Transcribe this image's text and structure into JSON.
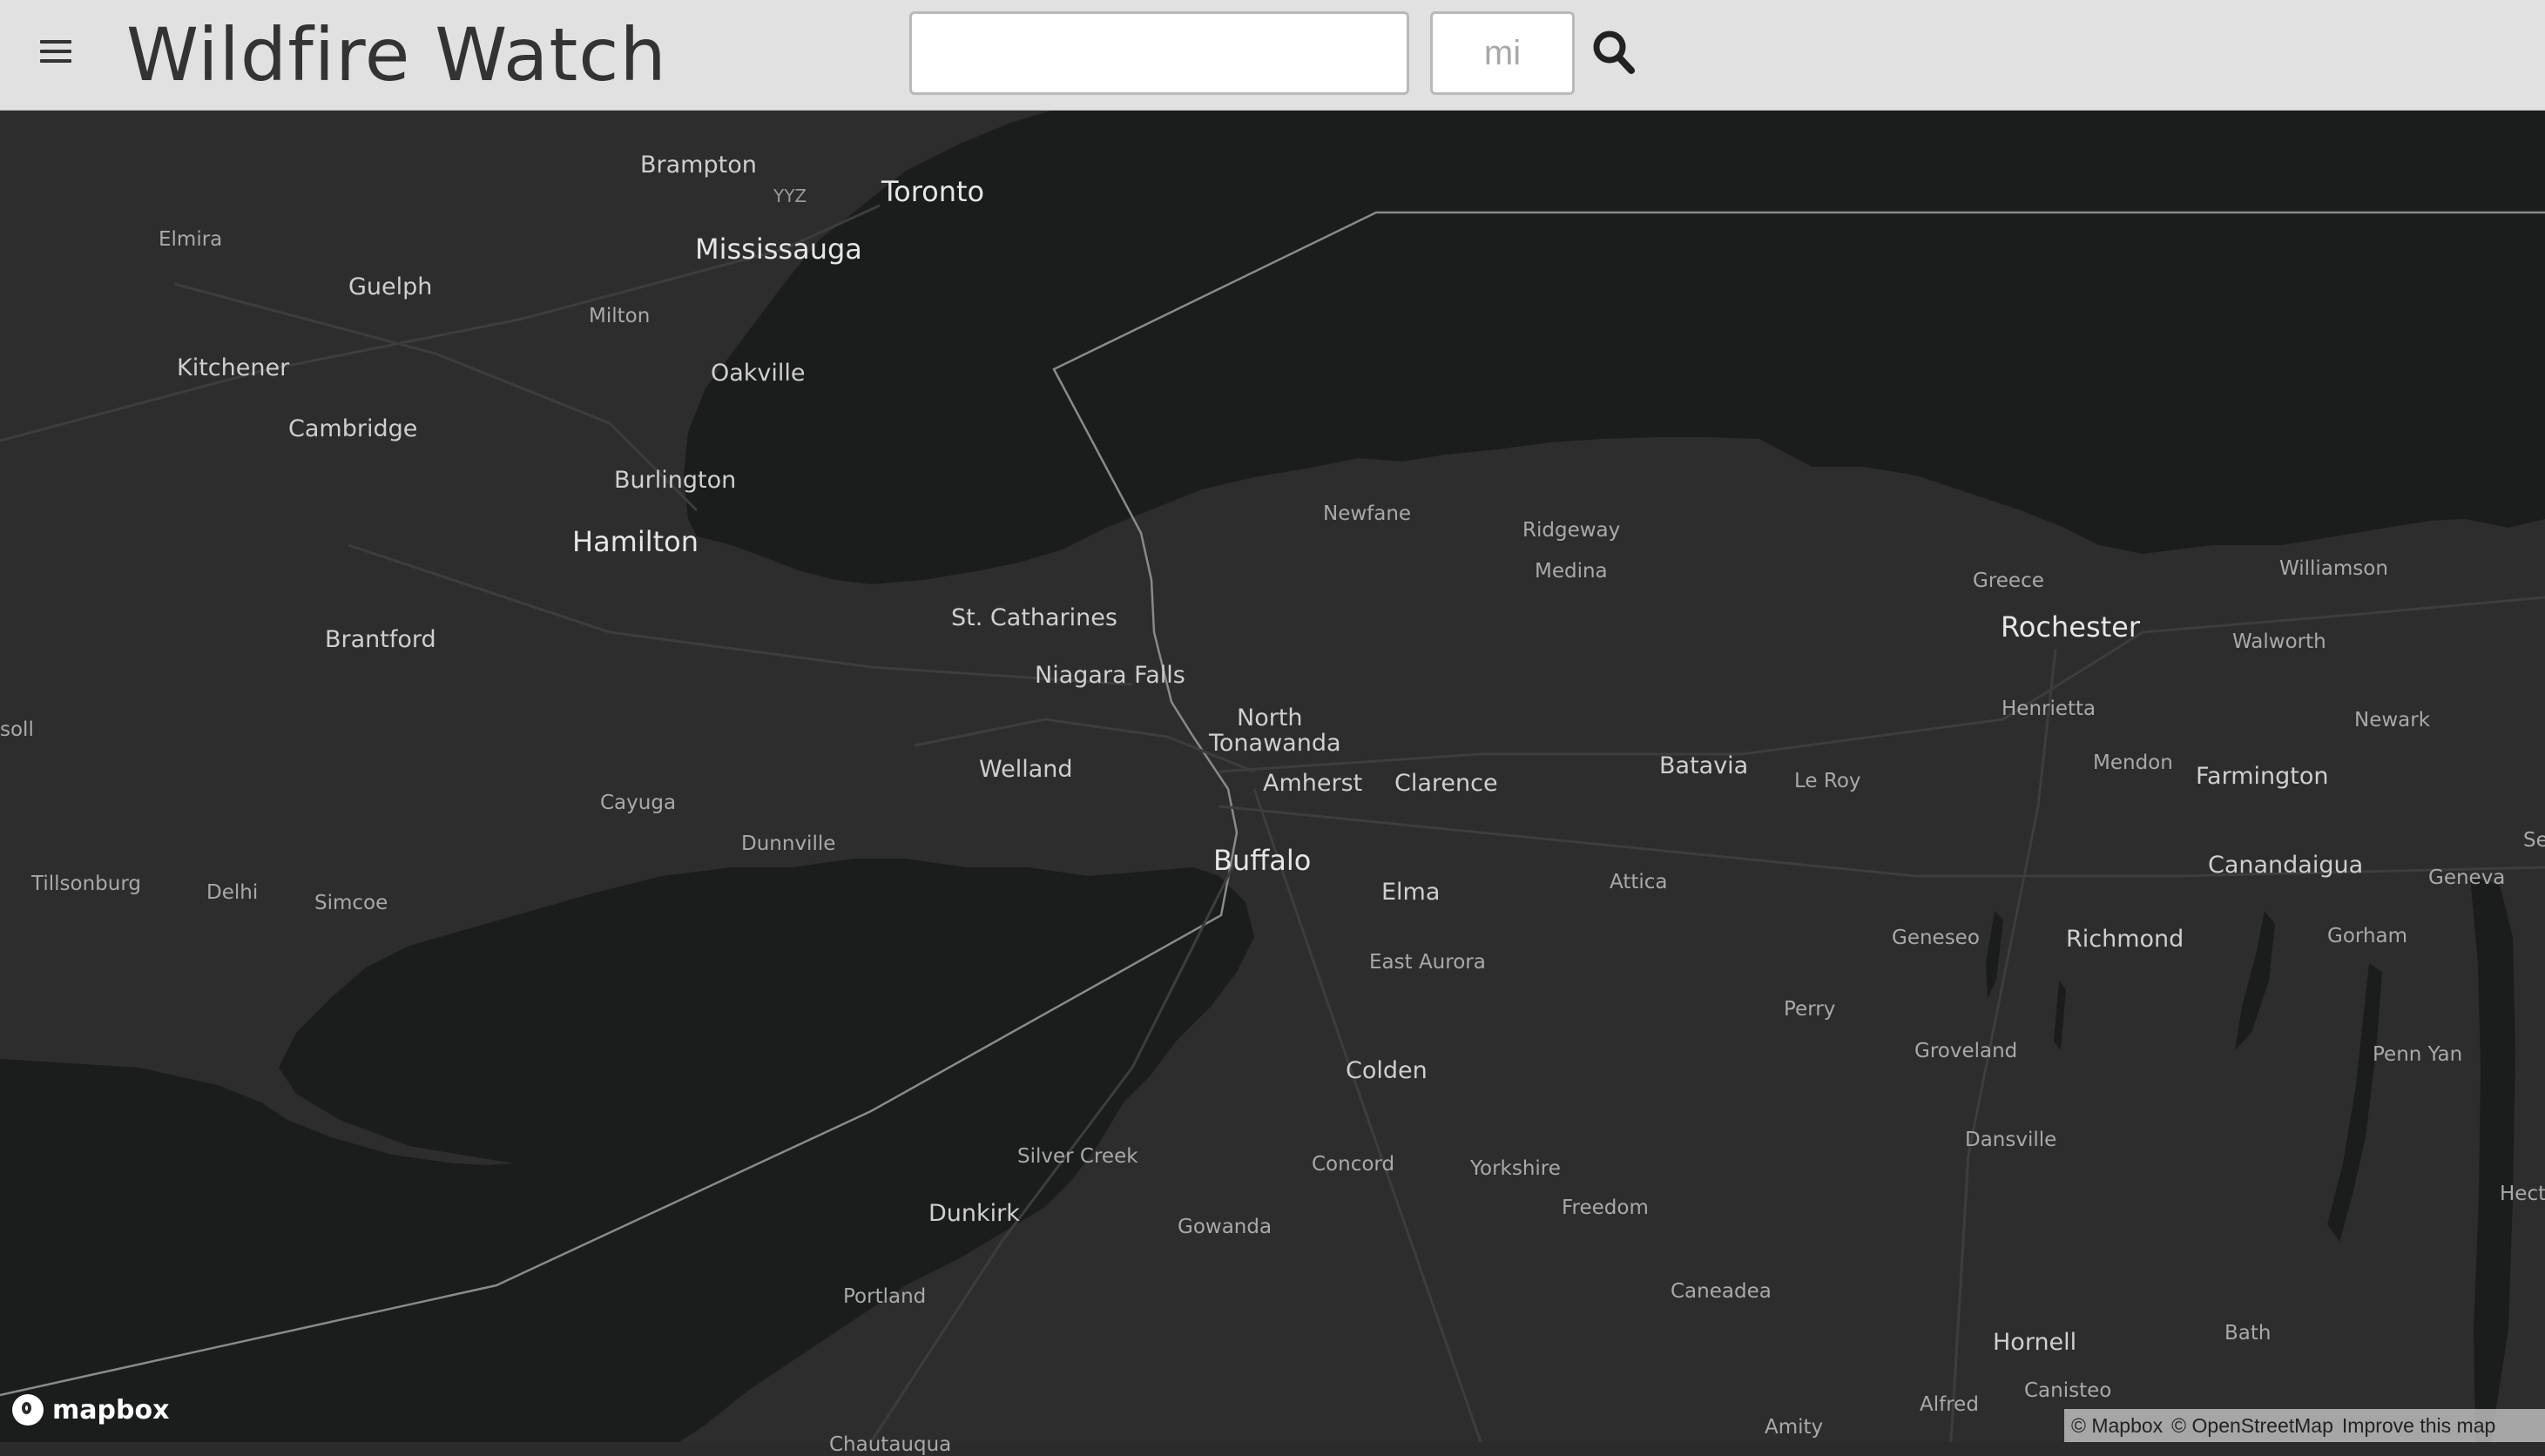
{
  "header": {
    "menu_icon": "hamburger-menu-icon",
    "title": "Wildfire Watch",
    "search_value": "",
    "miles_placeholder": "mi",
    "search_icon": "magnifier-search-icon"
  },
  "map": {
    "labels": {
      "brampton": "Brampton",
      "yyz": "YYZ",
      "toronto": "Toronto",
      "mississauga": "Mississauga",
      "elmira": "Elmira",
      "guelph": "Guelph",
      "milton": "Milton",
      "kitchener": "Kitchener",
      "oakville": "Oakville",
      "cambridge": "Cambridge",
      "burlington": "Burlington",
      "hamilton": "Hamilton",
      "brantford": "Brantford",
      "soll": "soll",
      "cayuga": "Cayuga",
      "dunnville": "Dunnville",
      "tillsonburg": "Tillsonburg",
      "delhi": "Delhi",
      "simcoe": "Simcoe",
      "st_catharines": "St. Catharines",
      "niagara_falls": "Niagara Falls",
      "welland": "Welland",
      "north": "North",
      "tonawanda": "Tonawanda",
      "amherst": "Amherst",
      "clarence": "Clarence",
      "buffalo": "Buffalo",
      "elma": "Elma",
      "east_aurora": "East Aurora",
      "colden": "Colden",
      "concord": "Concord",
      "yorkshire": "Yorkshire",
      "freedom": "Freedom",
      "silver_creek": "Silver Creek",
      "dunkirk": "Dunkirk",
      "gowanda": "Gowanda",
      "portland": "Portland",
      "newfane": "Newfane",
      "ridgeway": "Ridgeway",
      "medina": "Medina",
      "batavia": "Batavia",
      "le_roy": "Le Roy",
      "attica": "Attica",
      "perry": "Perry",
      "greece": "Greece",
      "rochester": "Rochester",
      "henrietta": "Henrietta",
      "williamson": "Williamson",
      "walworth": "Walworth",
      "newark": "Newark",
      "mendon": "Mendon",
      "farmington": "Farmington",
      "canandaigua": "Canandaigua",
      "geneva": "Geneva",
      "se": "Se",
      "geneseo": "Geneseo",
      "richmond": "Richmond",
      "gorham": "Gorham",
      "groveland": "Groveland",
      "penn_yan": "Penn Yan",
      "dansville": "Dansville",
      "hecto": "Hecto",
      "caneadea": "Caneadea",
      "hornell": "Hornell",
      "bath": "Bath",
      "canisteo": "Canisteo",
      "alfred": "Alfred",
      "amity": "Amity",
      "chautauqua": "Chautauqua"
    },
    "colors": {
      "land": "#2d2d2d",
      "water": "#1b1c1c",
      "border": "#8a8a8a"
    }
  },
  "footer": {
    "logo_text": "mapbox",
    "attribution": {
      "mapbox": "© Mapbox",
      "osm": "© OpenStreetMap",
      "improve": "Improve this map"
    }
  }
}
